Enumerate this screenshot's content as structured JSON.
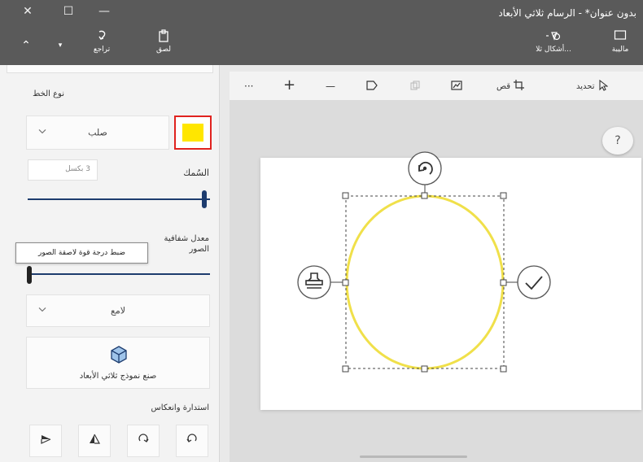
{
  "window": {
    "title": "بدون عنوان* - الرسام ثلاثي الأبعاد",
    "close_glyph": "✕",
    "maximize_glyph": "☐",
    "minimize_glyph": "—"
  },
  "ribbon": {
    "collapse_glyph": "⌃",
    "more_glyph": "▾",
    "redo_label": "تراجع",
    "paste_label": "لصق",
    "shapes3d_label": "أشكال ثلا...",
    "gallery_label": "ماليبة"
  },
  "panel": {
    "line_type_label": "نوع الخط",
    "line_type_value": "صلب",
    "color_swatch": "#ffe600",
    "thickness_label": "السُمك",
    "thickness_value": "3 بكسل",
    "thickness_fraction": 1.0,
    "opacity_label_1": "معدل شفافية",
    "opacity_label_2": "الصور",
    "opacity_fraction": 0.0,
    "tooltip": "ضبط درجة قوة لاصقة الصور",
    "finish_value": "لامع",
    "make3d_label": "صنع نموذج ثلاثي الأبعاد",
    "rotate_flip_label": "استدارة وانعكاس"
  },
  "toolbar": {
    "select_label": "تحديد",
    "crop_label": "قص",
    "more_glyph": "···",
    "plus_glyph": "+",
    "minus_glyph": "—"
  },
  "canvas": {
    "help_glyph": "?",
    "shape": "circle",
    "stroke_color": "#f0e04a"
  },
  "colors": {
    "titlebar": "#5a5a5a",
    "accent": "#1d3c6e",
    "highlight_border": "#e0231f"
  }
}
